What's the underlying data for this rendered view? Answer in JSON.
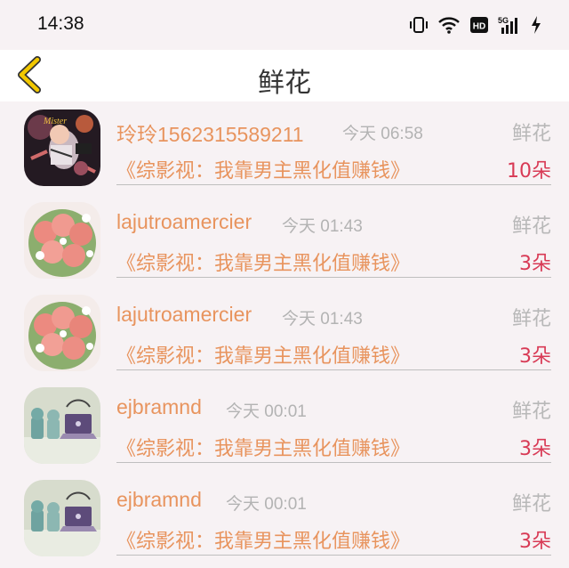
{
  "status_bar": {
    "time": "14:38",
    "icons": [
      "vibrate-icon",
      "wifi-icon",
      "hd-icon",
      "5g-signal-icon",
      "charging-icon"
    ]
  },
  "header": {
    "title": "鲜花",
    "back_icon": "chevron-left-icon"
  },
  "colors": {
    "accent": "#e8945e",
    "count": "#d83a55",
    "muted": "#b3b3b3",
    "back": "#f2c800"
  },
  "gifts": [
    {
      "user": "玲玲1562315589211",
      "time": "今天 06:58",
      "gift": "鲜花",
      "book": "《综影视：我靠男主黑化值赚钱》",
      "count": "10朵",
      "avatar": "baby-photo"
    },
    {
      "user": "lajutroamercier",
      "time": "今天 01:43",
      "gift": "鲜花",
      "book": "《综影视：我靠男主黑化值赚钱》",
      "count": "3朵",
      "avatar": "rose-bouquet"
    },
    {
      "user": "lajutroamercier",
      "time": "今天 01:43",
      "gift": "鲜花",
      "book": "《综影视：我靠男主黑化值赚钱》",
      "count": "3朵",
      "avatar": "rose-bouquet"
    },
    {
      "user": "ejbramnd",
      "time": "今天 00:01",
      "gift": "鲜花",
      "book": "《综影视：我靠男主黑化值赚钱》",
      "count": "3朵",
      "avatar": "toy-laptop"
    },
    {
      "user": "ejbramnd",
      "time": "今天 00:01",
      "gift": "鲜花",
      "book": "《综影视：我靠男主黑化值赚钱》",
      "count": "3朵",
      "avatar": "toy-laptop"
    }
  ]
}
